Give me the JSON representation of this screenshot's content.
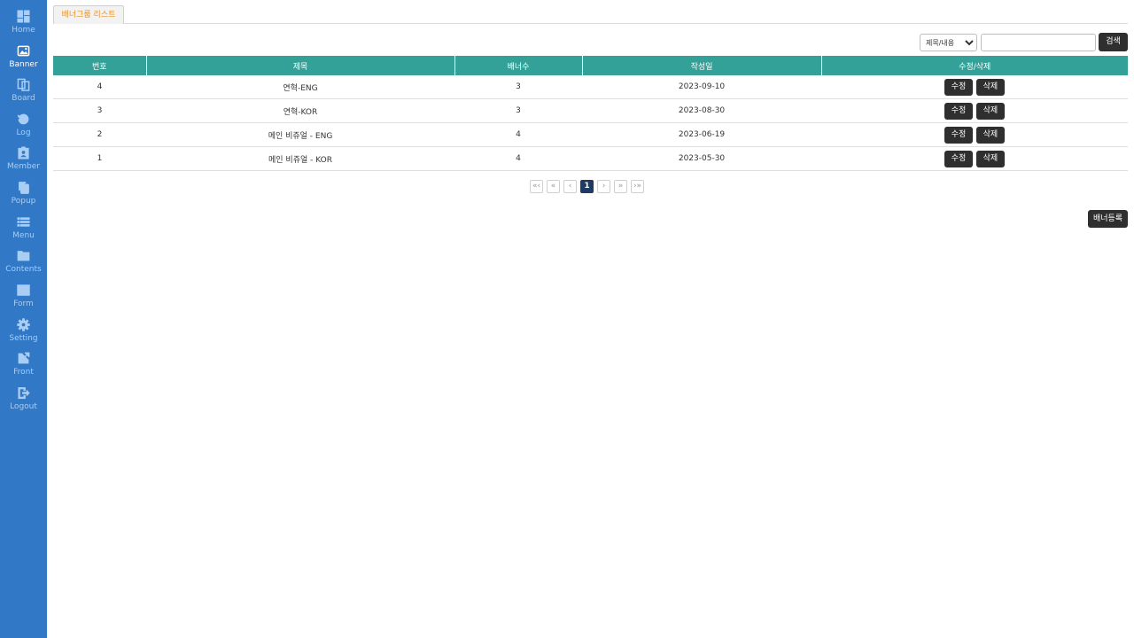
{
  "sidebar": {
    "items": [
      {
        "label": "Home",
        "icon": "dashboard-icon"
      },
      {
        "label": "Banner",
        "icon": "image-icon",
        "active": true
      },
      {
        "label": "Board",
        "icon": "board-icon"
      },
      {
        "label": "Log",
        "icon": "history-icon"
      },
      {
        "label": "Member",
        "icon": "member-icon"
      },
      {
        "label": "Popup",
        "icon": "copy-icon"
      },
      {
        "label": "Menu",
        "icon": "list-icon"
      },
      {
        "label": "Contents",
        "icon": "folder-icon"
      },
      {
        "label": "Form",
        "icon": "table-icon"
      },
      {
        "label": "Setting",
        "icon": "gear-icon"
      },
      {
        "label": "Front",
        "icon": "external-link-icon"
      },
      {
        "label": "Logout",
        "icon": "logout-icon"
      }
    ]
  },
  "tab": {
    "label": "배너그룹 리스트"
  },
  "search": {
    "select_value": "제목/내용",
    "input_value": "",
    "button_label": "검색"
  },
  "table": {
    "headers": [
      "번호",
      "제목",
      "배너수",
      "작성일",
      "수정/삭제"
    ],
    "rows": [
      {
        "no": "4",
        "title": "연혁-ENG",
        "count": "3",
        "date": "2023-09-10"
      },
      {
        "no": "3",
        "title": "연혁-KOR",
        "count": "3",
        "date": "2023-08-30"
      },
      {
        "no": "2",
        "title": "메인 비쥬얼 - ENG",
        "count": "4",
        "date": "2023-06-19"
      },
      {
        "no": "1",
        "title": "메인 비쥬얼 - KOR",
        "count": "4",
        "date": "2023-05-30"
      }
    ],
    "edit_label": "수정",
    "delete_label": "삭제"
  },
  "pagination": {
    "first": "«‹",
    "prev_block": "«",
    "prev": "‹",
    "current": "1",
    "next": "›",
    "next_block": "»",
    "last": "›»"
  },
  "register_button": "배너등록",
  "colors": {
    "sidebar": "#3178c6",
    "header": "#33a198",
    "button": "#2f2f2f",
    "tab_text": "#e8952b",
    "page_current": "#1f3b63"
  }
}
